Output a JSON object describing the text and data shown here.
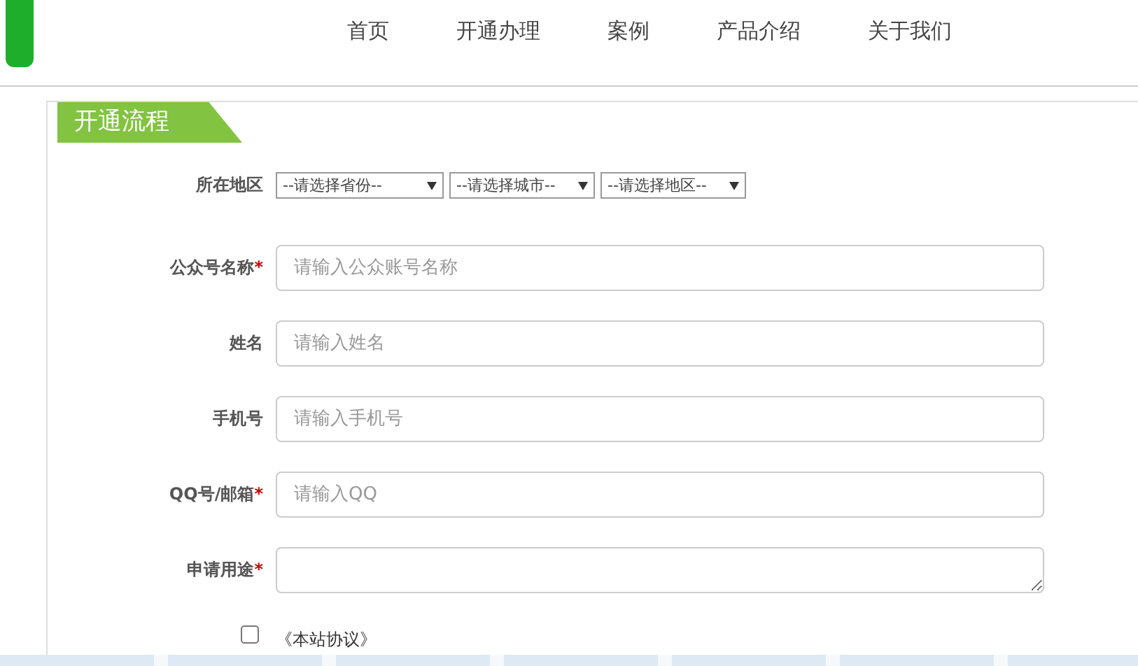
{
  "nav": [
    {
      "label": "首页"
    },
    {
      "label": "开通办理"
    },
    {
      "label": "案例"
    },
    {
      "label": "产品介绍"
    },
    {
      "label": "关于我们"
    }
  ],
  "section_title": "开通流程",
  "region": {
    "label": "所在地区",
    "selects": [
      "--请选择省份--",
      "--请选择城市--",
      "--请选择地区--"
    ]
  },
  "fields": [
    {
      "kind": "input",
      "label": "公众号名称",
      "required_mark": "*",
      "placeholder": "请输入公众账号名称"
    },
    {
      "kind": "input",
      "label": "姓名",
      "placeholder": "请输入姓名"
    },
    {
      "kind": "input",
      "label": "手机号",
      "placeholder": "请输入手机号"
    },
    {
      "kind": "input",
      "label": "QQ号/邮箱",
      "required_mark": "*",
      "placeholder": "请输入QQ"
    },
    {
      "kind": "textarea",
      "label": "申请用途",
      "required_mark": "*"
    }
  ],
  "agreement": {
    "checked": false,
    "label": "《本站协议》"
  }
}
